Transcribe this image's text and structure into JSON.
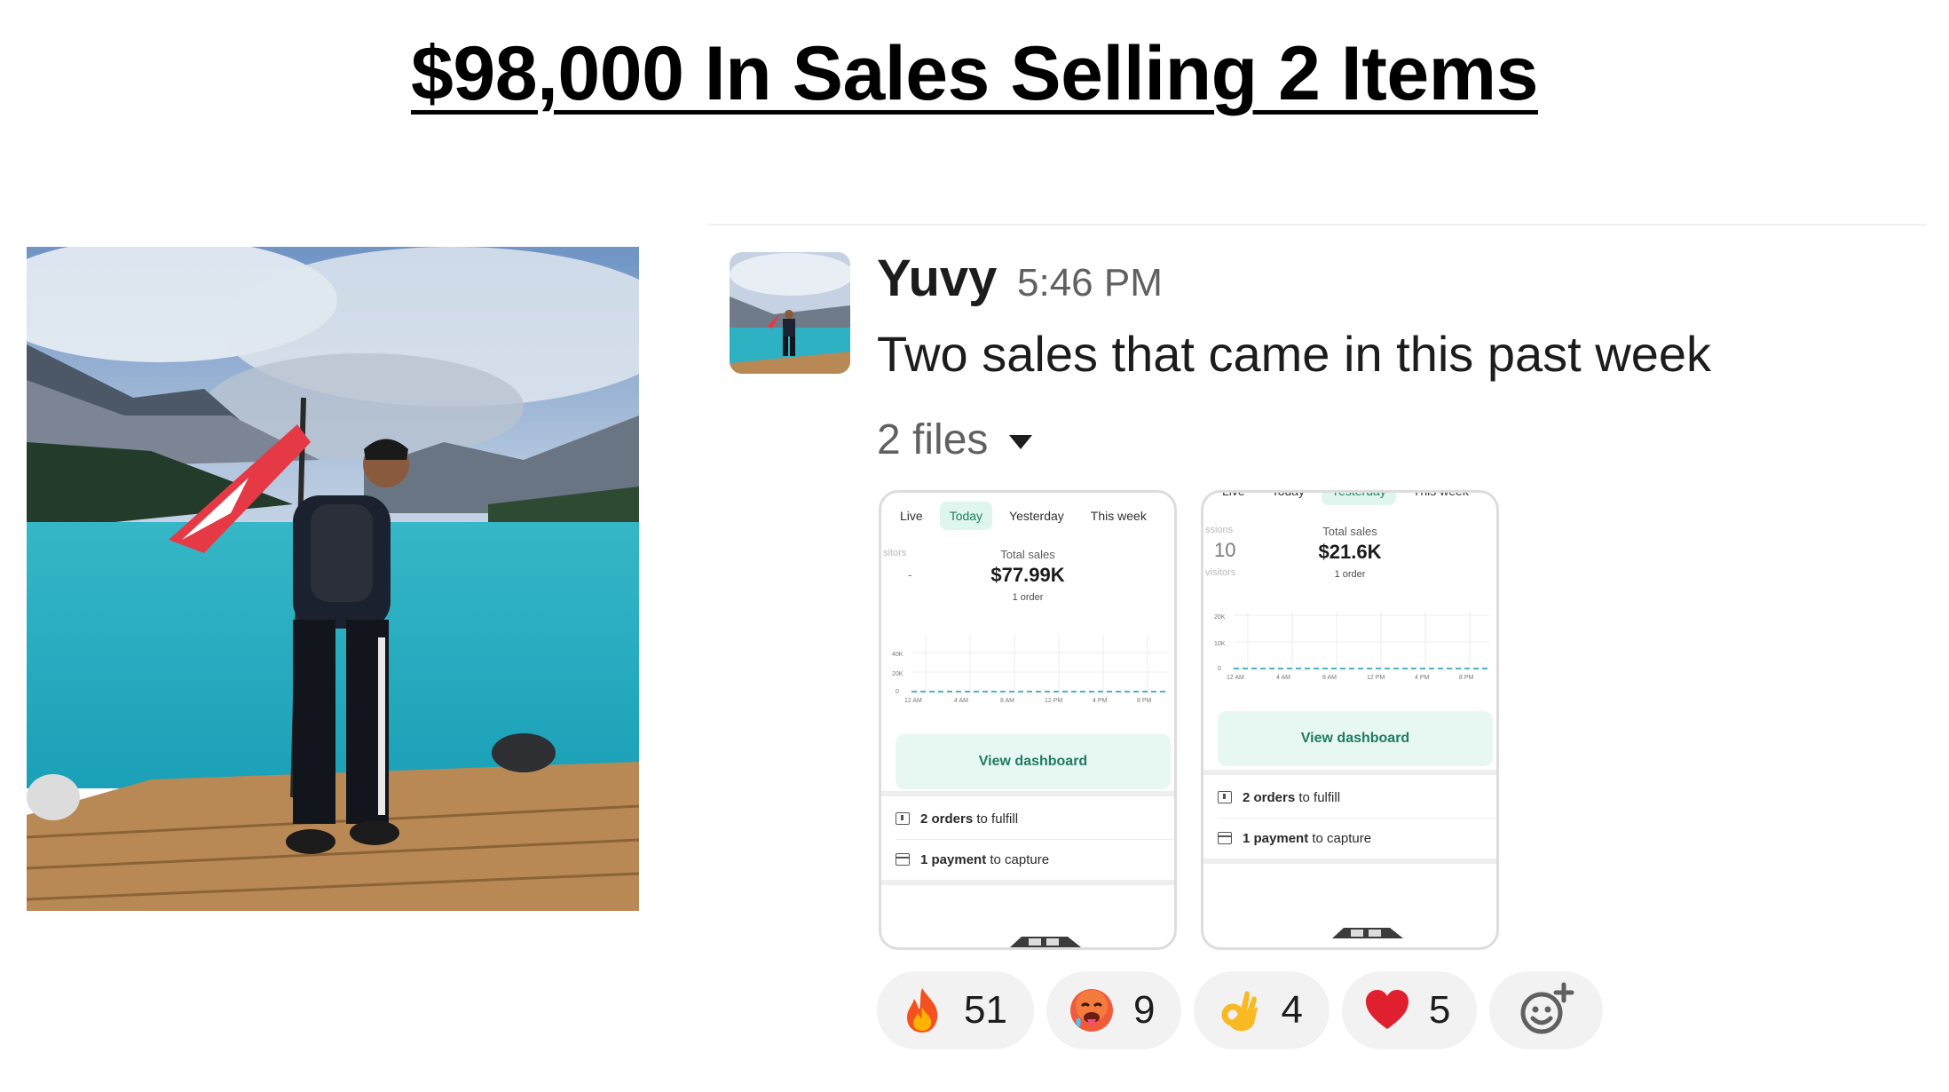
{
  "headline": "$98,000 In Sales Selling 2 Items",
  "message": {
    "author": "Yuvy",
    "time": "5:46 PM",
    "text": "Two sales that came in this past week",
    "files_label": "2 files"
  },
  "files": [
    {
      "tabs": [
        "Live",
        "Today",
        "Yesterday",
        "This week"
      ],
      "active_tab": "Today",
      "side_label": "sitors",
      "side_value": "-",
      "total_label": "Total sales",
      "total_value": "$77.99K",
      "orders": "1 order",
      "y_ticks": [
        "40K",
        "20K",
        "0"
      ],
      "x_ticks": [
        "12 AM",
        "4 AM",
        "8 AM",
        "12 PM",
        "4 PM",
        "8 PM"
      ],
      "button_label": "View dashboard",
      "task1_bold": "2 orders",
      "task1_rest": "to fulfill",
      "task2_bold": "1 payment",
      "task2_rest": "to capture"
    },
    {
      "tabs": [
        "Live",
        "Today",
        "Yesterday",
        "This week"
      ],
      "active_tab": "Yesterday",
      "side_label": "ssions",
      "side_value": "10",
      "side_label2": "visitors",
      "total_label": "Total sales",
      "total_value": "$21.6K",
      "orders": "1 order",
      "y_ticks": [
        "20K",
        "10K",
        "0"
      ],
      "x_ticks": [
        "12 AM",
        "4 AM",
        "8 AM",
        "12 PM",
        "4 PM",
        "8 PM"
      ],
      "button_label": "View dashboard",
      "task1_bold": "2 orders",
      "task1_rest": "to fulfill",
      "task2_bold": "1 payment",
      "task2_rest": "to capture"
    }
  ],
  "reactions": [
    {
      "emoji": "fire",
      "count": "51"
    },
    {
      "emoji": "hot-face",
      "count": "9"
    },
    {
      "emoji": "ok-hand",
      "count": "4"
    },
    {
      "emoji": "red-heart",
      "count": "5"
    }
  ],
  "colors": {
    "accent_green": "#1f7c61",
    "reaction_bg": "#f2f2f2",
    "muted_text": "#616061"
  }
}
